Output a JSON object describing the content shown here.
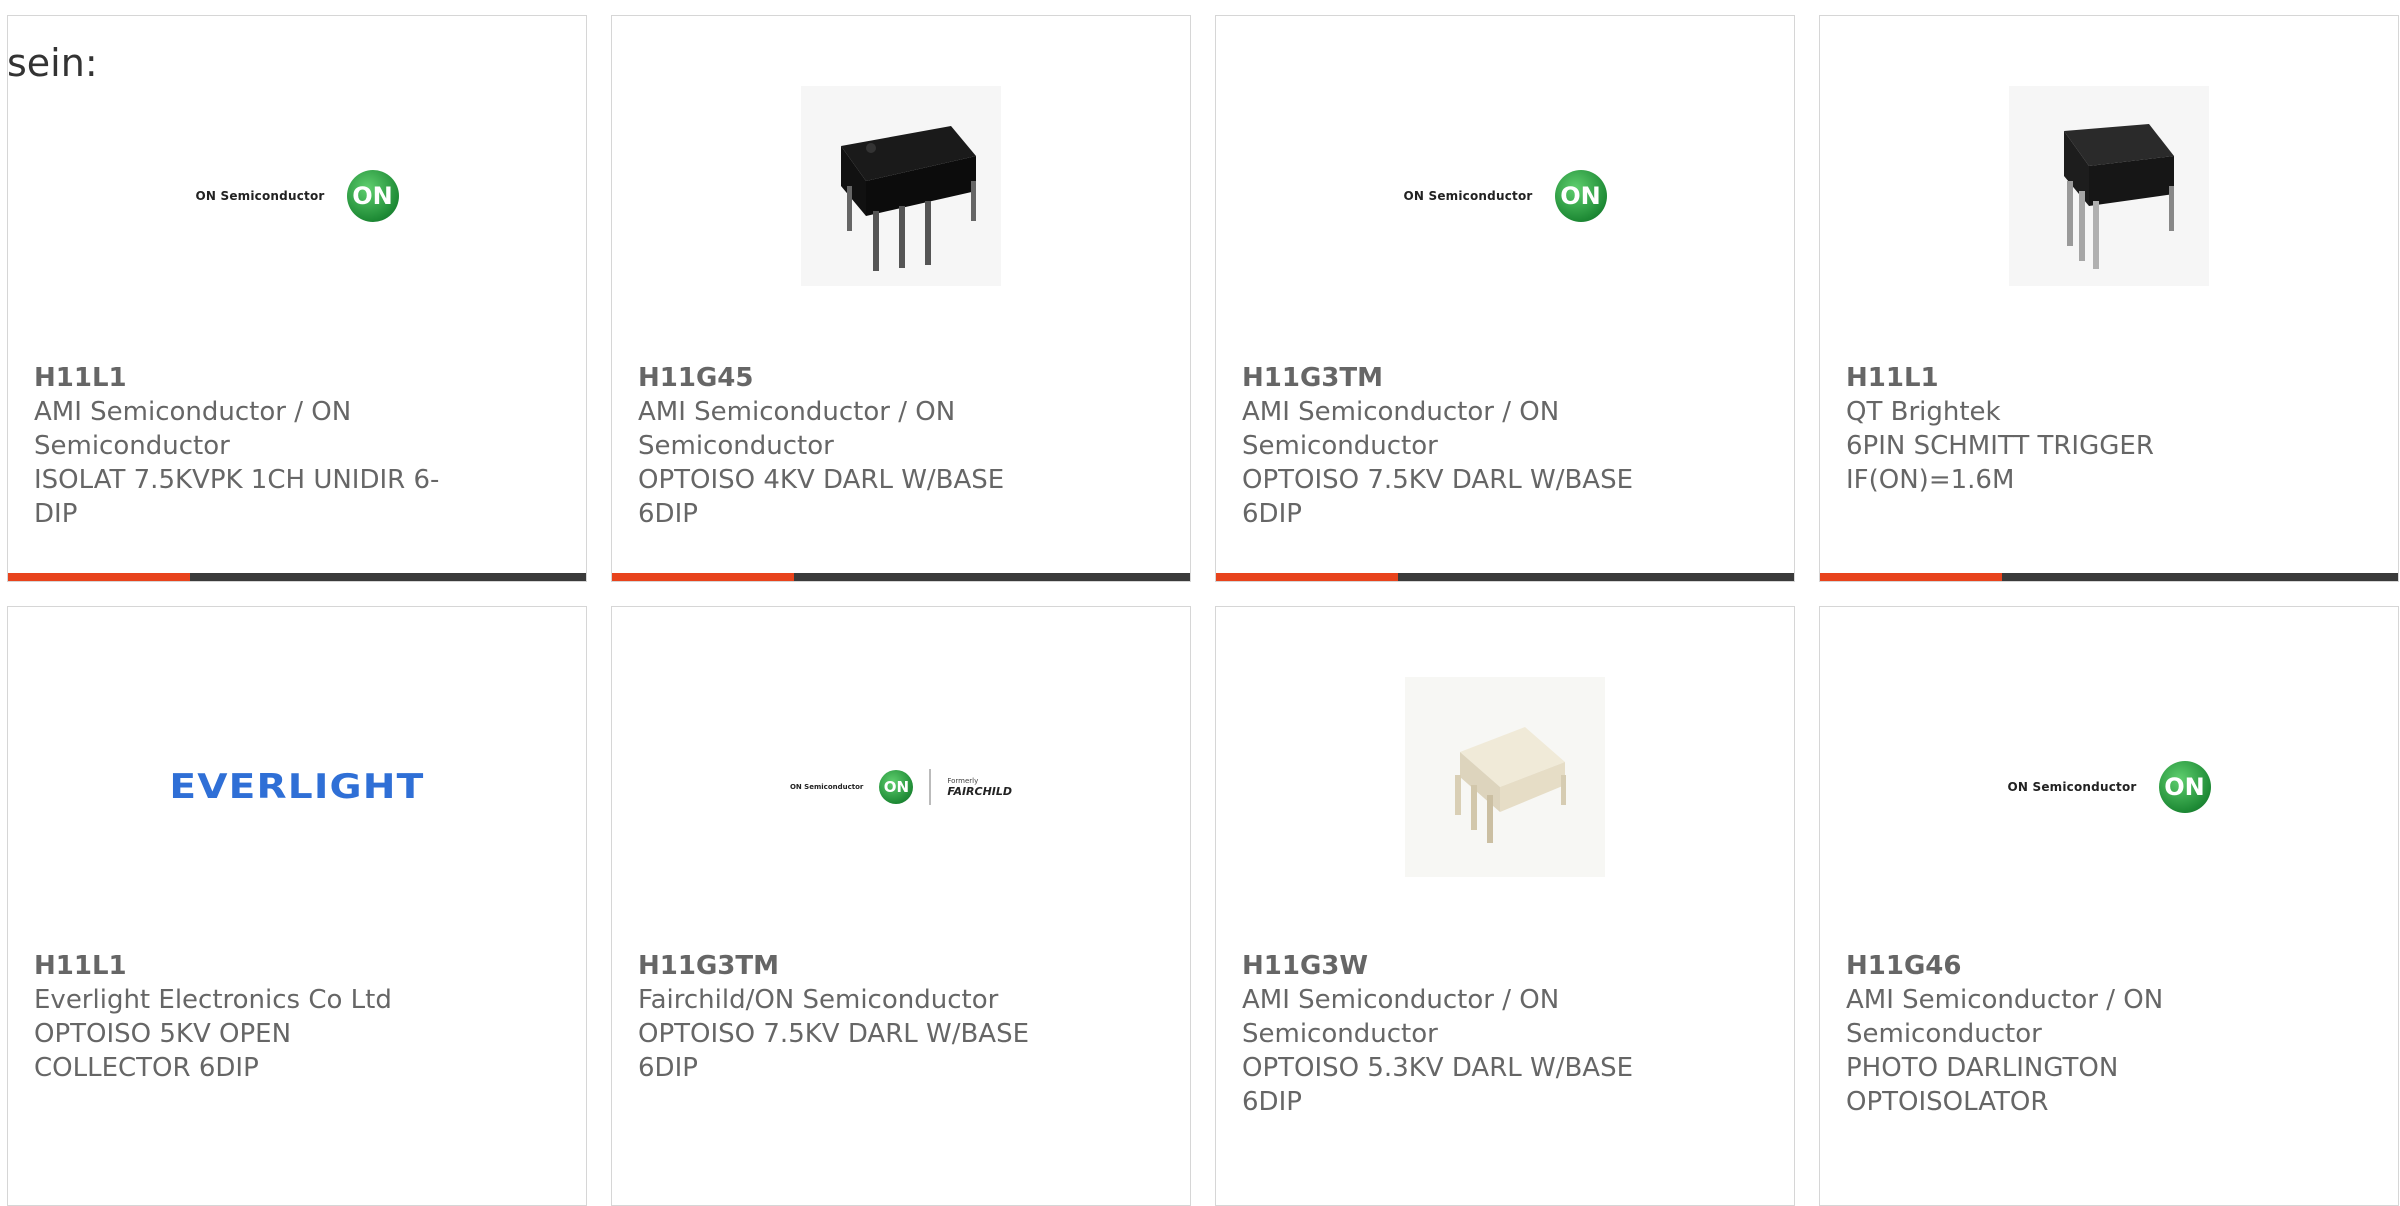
{
  "lead_text": "sein:",
  "colors": {
    "accent": "#e8431c",
    "bar": "#3a3a3a",
    "text": "#666666",
    "on_green": "#1e8a35",
    "everlight_blue": "#2f6fd6"
  },
  "logos": {
    "on_text": "ON Semiconductor",
    "on_mark": "ON",
    "everlight": "EVERLIGHT",
    "fairchild_formerly": "Formerly",
    "fairchild": "FAIRCHILD"
  },
  "products": [
    {
      "part": "H11L1",
      "manufacturer": "AMI Semiconductor / ON Semiconductor",
      "description": "ISOLAT 7.5KVPK 1CH UNIDIR 6-DIP",
      "image": "on-semiconductor-logo"
    },
    {
      "part": "H11G45",
      "manufacturer": "AMI Semiconductor / ON Semiconductor",
      "description": "OPTOISO 4KV DARL W/BASE 6DIP",
      "image": "black-6dip-chip"
    },
    {
      "part": "H11G3TM",
      "manufacturer": "AMI Semiconductor / ON Semiconductor",
      "description": "OPTOISO 7.5KV DARL W/BASE 6DIP",
      "image": "on-semiconductor-logo"
    },
    {
      "part": "H11L1",
      "manufacturer": "QT Brightek",
      "description": "6PIN SCHMITT TRIGGER IF(ON)=1.6M",
      "image": "black-6dip-chip-small"
    },
    {
      "part": "H11L1",
      "manufacturer": "Everlight Electronics Co Ltd",
      "description": "OPTOISO 5KV OPEN COLLECTOR 6DIP",
      "image": "everlight-logo"
    },
    {
      "part": "H11G3TM",
      "manufacturer": "Fairchild/ON Semiconductor",
      "description": "OPTOISO 7.5KV DARL W/BASE 6DIP",
      "image": "on-fairchild-logo"
    },
    {
      "part": "H11G3W",
      "manufacturer": "AMI Semiconductor / ON Semiconductor",
      "description": "OPTOISO 5.3KV DARL W/BASE 6DIP",
      "image": "white-6dip-chip"
    },
    {
      "part": "H11G46",
      "manufacturer": "AMI Semiconductor / ON Semiconductor",
      "description": "PHOTO DARLINGTON OPTOISOLATOR",
      "image": "on-semiconductor-logo"
    }
  ]
}
